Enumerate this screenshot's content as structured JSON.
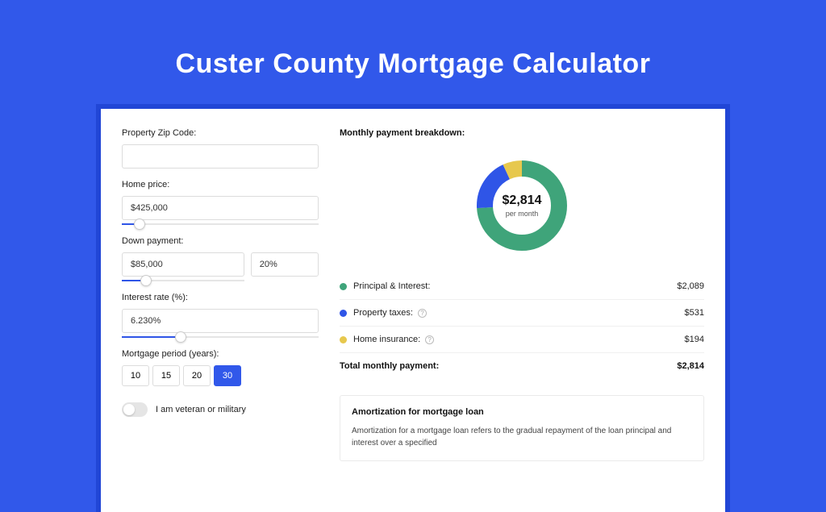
{
  "page_title": "Custer County Mortgage Calculator",
  "form": {
    "zip": {
      "label": "Property Zip Code:",
      "value": ""
    },
    "home_price": {
      "label": "Home price:",
      "value": "$425,000",
      "slider_pct": 9
    },
    "down_payment": {
      "label": "Down payment:",
      "value": "$85,000",
      "pct_value": "20%",
      "slider_pct": 20
    },
    "interest_rate": {
      "label": "Interest rate (%):",
      "value": "6.230%",
      "slider_pct": 30
    },
    "period": {
      "label": "Mortgage period (years):",
      "options": [
        "10",
        "15",
        "20",
        "30"
      ],
      "selected": "30"
    },
    "veteran": {
      "label": "I am veteran or military",
      "value": false
    }
  },
  "breakdown": {
    "heading": "Monthly payment breakdown:",
    "donut": {
      "center_value": "$2,814",
      "center_sub": "per month"
    },
    "items": [
      {
        "label": "Principal & Interest:",
        "value": "$2,089",
        "color": "#3fa47a",
        "info": false,
        "pct": 74
      },
      {
        "label": "Property taxes:",
        "value": "$531",
        "color": "#2f55e7",
        "info": true,
        "pct": 19
      },
      {
        "label": "Home insurance:",
        "value": "$194",
        "color": "#e7c84d",
        "info": true,
        "pct": 7
      }
    ],
    "total": {
      "label": "Total monthly payment:",
      "value": "$2,814"
    }
  },
  "amort": {
    "heading": "Amortization for mortgage loan",
    "body": "Amortization for a mortgage loan refers to the gradual repayment of the loan principal and interest over a specified"
  }
}
